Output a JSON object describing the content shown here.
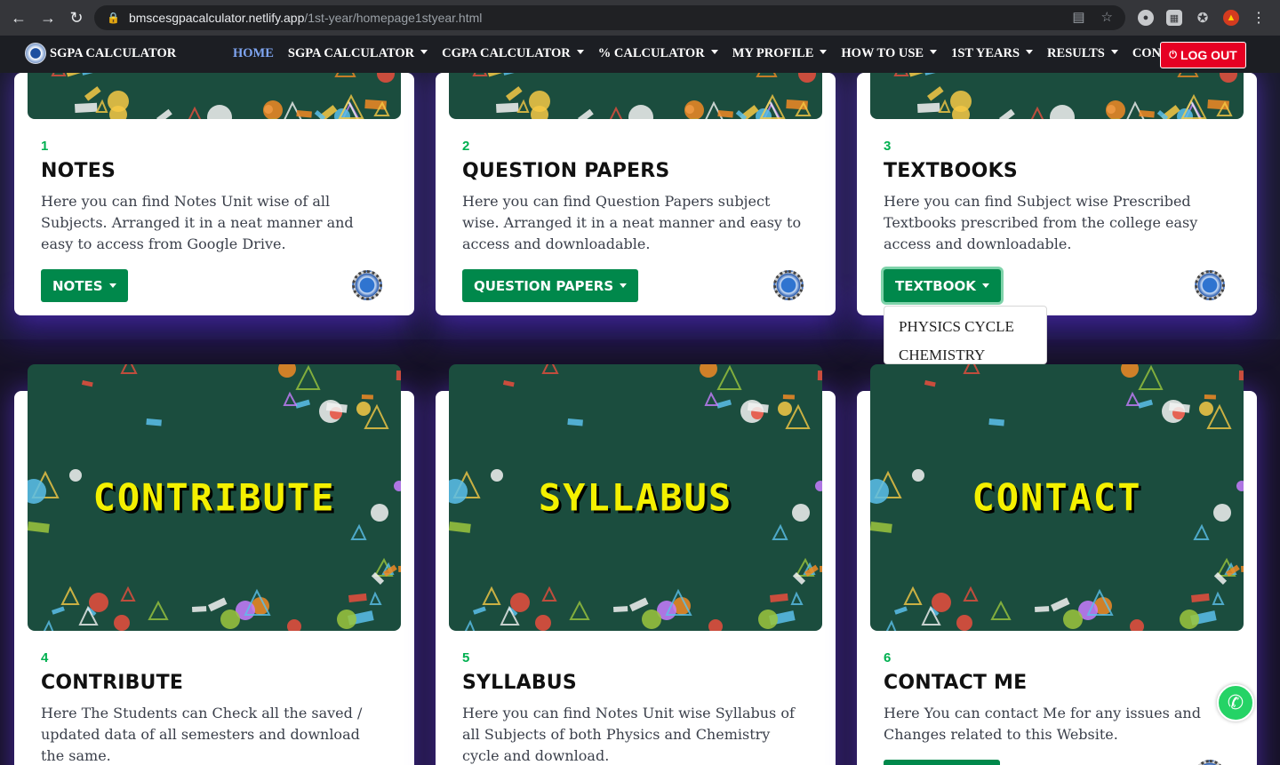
{
  "browser": {
    "url_host": "bmscesgpacalculator.netlify.app",
    "url_path": "/1st-year/homepage1styear.html",
    "back_icon": "arrow-left-icon",
    "forward_icon": "arrow-right-icon",
    "reload_icon": "reload-icon"
  },
  "navbar": {
    "brand": "SGPA CALCULATOR",
    "items": [
      {
        "label": "HOME",
        "active": true,
        "dropdown": false
      },
      {
        "label": "SGPA CALCULATOR",
        "dropdown": true
      },
      {
        "label": "CGPA CALCULATOR",
        "dropdown": true
      },
      {
        "label": "% CALCULATOR",
        "dropdown": true
      },
      {
        "label": "MY PROFILE",
        "dropdown": true
      },
      {
        "label": "HOW TO USE",
        "dropdown": true
      },
      {
        "label": "1ST YEARS",
        "dropdown": true
      },
      {
        "label": "RESULTS",
        "dropdown": true
      },
      {
        "label": "CONTACT",
        "dropdown": false
      }
    ],
    "logout_label": "LOG OUT"
  },
  "cards": [
    {
      "num": "1",
      "title": "NOTES",
      "desc": "Here you can find Notes Unit wise of all Subjects. Arranged it in a neat manner and easy to access from Google Drive.",
      "button": "NOTES"
    },
    {
      "num": "2",
      "title": "QUESTION PAPERS",
      "desc": "Here you can find Question Papers subject wise. Arranged it in a neat manner and easy to access and downloadable.",
      "button": "QUESTION PAPERS"
    },
    {
      "num": "3",
      "title": "TEXTBOOKS",
      "desc": "Here you can find Subject wise Prescribed Textbooks prescribed from the college easy access and downloadable.",
      "button": "TEXTBOOK"
    },
    {
      "num": "4",
      "title": "CONTRIBUTE",
      "desc": "Here The Students can Check all the saved / updated data of all semesters and download the same.",
      "banner": "CONTRIBUTE"
    },
    {
      "num": "5",
      "title": "SYLLABUS",
      "desc": "Here you can find Notes Unit wise Syllabus of all Subjects of both Physics and Chemistry cycle and download.",
      "banner": "SYLLABUS"
    },
    {
      "num": "6",
      "title": "CONTACT ME",
      "desc": "Here You can contact Me for any issues and Changes related to this Website.",
      "banner": "CONTACT"
    }
  ],
  "textbook_dropdown": [
    "PHYSICS CYCLE",
    "CHEMISTRY CYCLE"
  ],
  "colors": {
    "accent_green": "#00884b",
    "number_green": "#00b050",
    "logout_red": "#e60023",
    "banner_yellow": "#f4f000"
  }
}
